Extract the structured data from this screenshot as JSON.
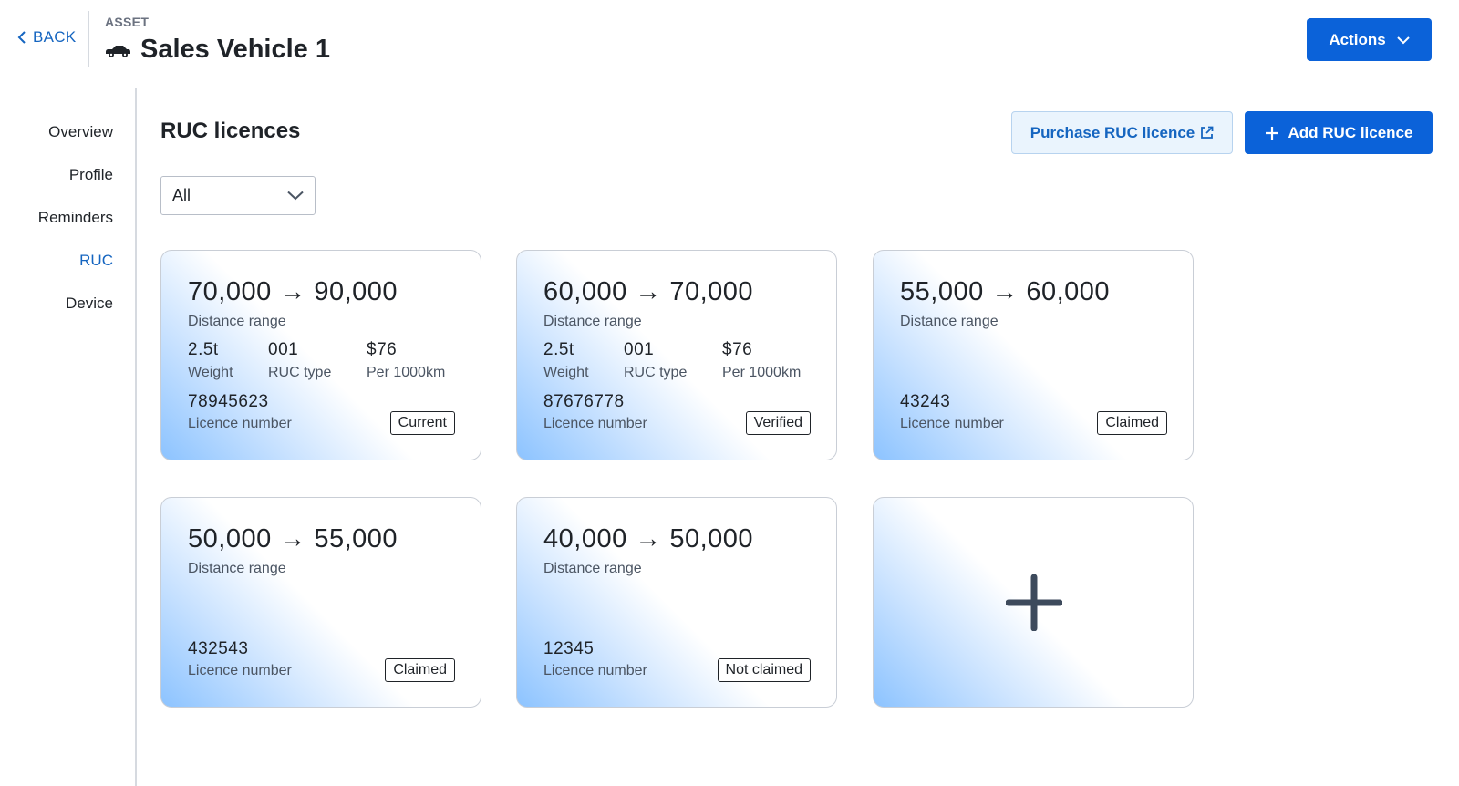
{
  "header": {
    "back_label": "BACK",
    "asset_label": "ASSET",
    "title": "Sales Vehicle 1",
    "actions_label": "Actions",
    "title_icon": "car-icon"
  },
  "sidebar": {
    "items": [
      {
        "label": "Overview",
        "active": false
      },
      {
        "label": "Profile",
        "active": false
      },
      {
        "label": "Reminders",
        "active": false
      },
      {
        "label": "RUC",
        "active": true
      },
      {
        "label": "Device",
        "active": false
      }
    ]
  },
  "main": {
    "section_title": "RUC licences",
    "purchase_label": "Purchase RUC licence",
    "add_label": "Add RUC licence",
    "filter": {
      "selected": "All"
    },
    "cards": [
      {
        "range": "70,000 → 90,000",
        "range_label": "Distance range",
        "weight": "2.5t",
        "weight_label": "Weight",
        "ruc_type": "001",
        "ruc_type_label": "RUC type",
        "price": "$76",
        "price_label": "Per 1000km",
        "licence_number": "78945623",
        "licence_label": "Licence number",
        "status": "Current"
      },
      {
        "range": "60,000 → 70,000",
        "range_label": "Distance range",
        "weight": "2.5t",
        "weight_label": "Weight",
        "ruc_type": "001",
        "ruc_type_label": "RUC type",
        "price": "$76",
        "price_label": "Per 1000km",
        "licence_number": "87676778",
        "licence_label": "Licence number",
        "status": "Verified"
      },
      {
        "range": "55,000 → 60,000",
        "range_label": "Distance range",
        "licence_number": "43243",
        "licence_label": "Licence number",
        "status": "Claimed"
      },
      {
        "range": "50,000 → 55,000",
        "range_label": "Distance range",
        "licence_number": "432543",
        "licence_label": "Licence number",
        "status": "Claimed"
      },
      {
        "range": "40,000 → 50,000",
        "range_label": "Distance range",
        "licence_number": "12345",
        "licence_label": "Licence number",
        "status": "Not claimed"
      }
    ]
  },
  "colors": {
    "primary": "#0b62d9",
    "link": "#1565c0",
    "card_gradient": "#8cc3ff"
  }
}
